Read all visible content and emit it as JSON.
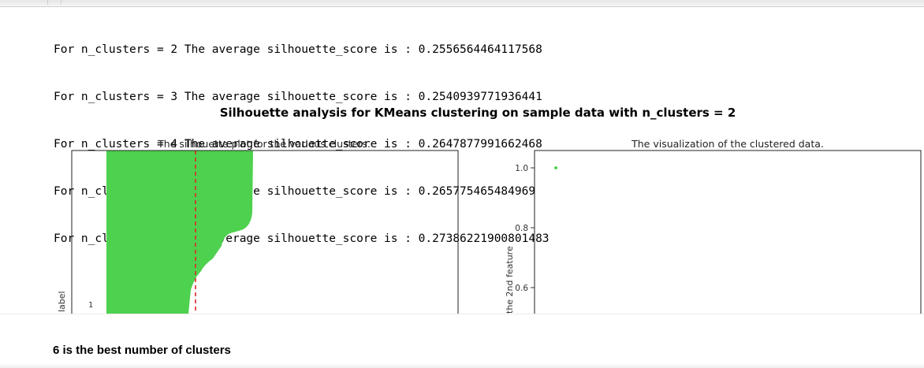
{
  "output": {
    "lines": [
      "For n_clusters = 2 The average silhouette_score is : 0.2556564464117568",
      "For n_clusters = 3 The average silhouette_score is : 0.2540939771936441",
      "For n_clusters = 4 The average silhouette_score is : 0.2647877991662468",
      "For n_clusters = 5 The average silhouette_score is : 0.265775465484969",
      "For n_clusters = 6 The average silhouette_score is : 0.27386221900801483"
    ]
  },
  "figure": {
    "title": "Silhouette analysis for KMeans clustering on sample data with n_clusters = 2"
  },
  "chart_data": [
    {
      "type": "area",
      "title": "The silhouette plot for the various clusters.",
      "xlabel": "",
      "ylabel": "label",
      "y_tick_labels": [
        "1"
      ],
      "average_score_line": 0.2556564464117568,
      "colors": {
        "fill": "#4ed14e",
        "average_line": "#e0262a"
      }
    },
    {
      "type": "scatter",
      "title": "The visualization of the clustered data.",
      "xlabel": "",
      "ylabel": "the 2nd feature",
      "y_ticks": [
        1.0,
        0.8,
        0.6
      ],
      "y_tick_labels": [
        "1.0",
        "0.8",
        "0.6"
      ],
      "points": [
        {
          "x": 0.0,
          "y": 1.0
        }
      ],
      "colors": {
        "point": "#2cc92c"
      }
    }
  ],
  "footer": {
    "best": "6 is the best number of clusters"
  }
}
